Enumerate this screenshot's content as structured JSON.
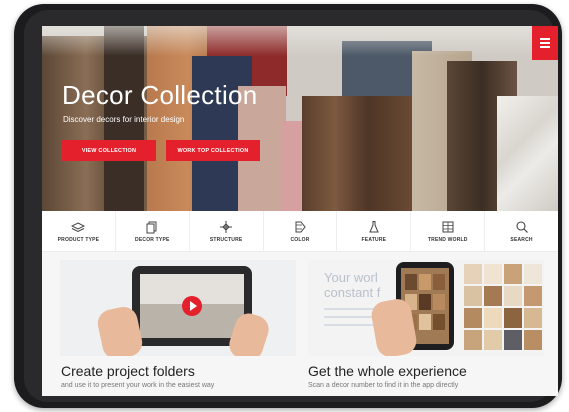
{
  "hero": {
    "title": "Decor Collection",
    "subtitle": "Discover decors for interior design",
    "view_button": "VIEW COLLECTION",
    "worktop_button": "WORK TOP COLLECTION"
  },
  "nav": {
    "items": [
      {
        "label": "PRODUCT TYPE",
        "icon": "layers-icon"
      },
      {
        "label": "DECOR TYPE",
        "icon": "panels-icon"
      },
      {
        "label": "STRUCTURE",
        "icon": "structure-icon"
      },
      {
        "label": "COLOR",
        "icon": "palette-icon"
      },
      {
        "label": "FEATURE",
        "icon": "flask-icon"
      },
      {
        "label": "TREND WORLD",
        "icon": "grid-icon"
      },
      {
        "label": "SEARCH",
        "icon": "search-icon"
      }
    ]
  },
  "cards": [
    {
      "title": "Create project folders",
      "description": "and use it to present your work in the easiest way"
    },
    {
      "title": "Get the whole experience",
      "description": "Scan a decor number to find it in the app directly"
    }
  ],
  "card2_art_text": "Your worl constant f",
  "colors": {
    "accent": "#e3202b"
  }
}
